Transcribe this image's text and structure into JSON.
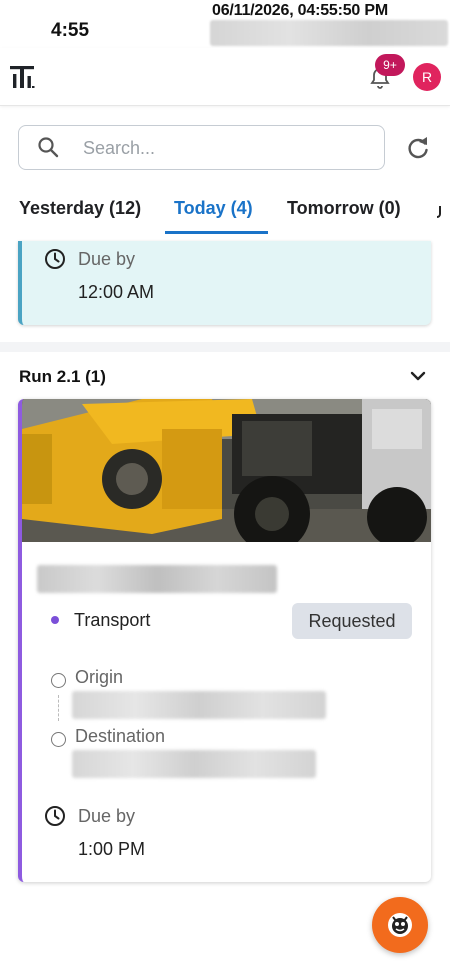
{
  "status_bar": {
    "time": "4:55",
    "timestamp": "06/11/2026, 04:55:50 PM"
  },
  "header": {
    "logo": "app-logo",
    "notifications": {
      "icon": "bell-icon",
      "badge": "9+"
    },
    "avatar_initial": "R"
  },
  "search": {
    "placeholder": "Search...",
    "value": ""
  },
  "tabs": [
    {
      "label": "Yesterday (12)",
      "active": false
    },
    {
      "label": "Today (4)",
      "active": true
    },
    {
      "label": "Tomorrow (0)",
      "active": false
    }
  ],
  "previous_card": {
    "due_label": "Due by",
    "due_value": "12:00 AM"
  },
  "group": {
    "title": "Run 2.1 (1)"
  },
  "task_card": {
    "type": "Transport",
    "status": "Requested",
    "origin_label": "Origin",
    "destination_label": "Destination",
    "due_label": "Due by",
    "due_value": "1:00 PM"
  },
  "colors": {
    "accent": "#1a73c8",
    "badge": "#c2185b",
    "avatar": "#e0245e",
    "prev_card_border": "#4aa3c3",
    "prev_card_bg": "#e3f5f6",
    "task_card_border": "#8e5be0",
    "fab": "#f26b1d"
  }
}
